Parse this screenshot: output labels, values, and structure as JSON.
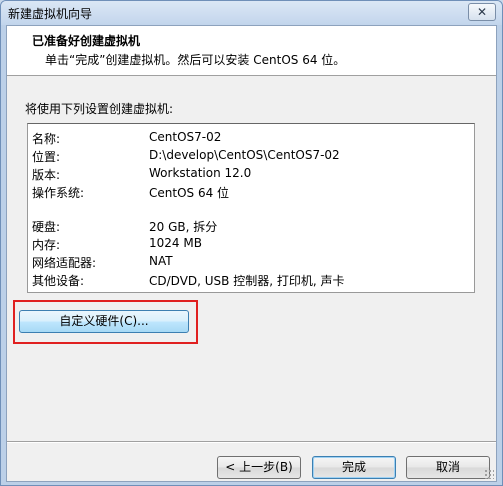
{
  "window": {
    "title": "新建虚拟机向导",
    "close_symbol": "✕"
  },
  "header": {
    "title": "已准备好创建虚拟机",
    "subtitle": "单击“完成”创建虚拟机。然后可以安装 CentOS 64 位。"
  },
  "intro": "将使用下列设置创建虚拟机:",
  "summary": {
    "rows": [
      {
        "label": "名称:",
        "value": "CentOS7-02"
      },
      {
        "label": "位置:",
        "value": "D:\\develop\\CentOS\\CentOS7-02"
      },
      {
        "label": "版本:",
        "value": "Workstation 12.0"
      },
      {
        "label": "操作系统:",
        "value": "CentOS 64 位"
      },
      {
        "label": "硬盘:",
        "value": "20 GB, 拆分"
      },
      {
        "label": "内存:",
        "value": "1024 MB"
      },
      {
        "label": "网络适配器:",
        "value": "NAT"
      },
      {
        "label": "其他设备:",
        "value": "CD/DVD, USB 控制器, 打印机, 声卡"
      }
    ]
  },
  "buttons": {
    "customize": "自定义硬件(C)...",
    "back": "< 上一步(B)",
    "finish": "完成",
    "cancel": "取消"
  },
  "colors": {
    "annotation_box": "#e02020",
    "focus_border": "#3c7fb1"
  }
}
